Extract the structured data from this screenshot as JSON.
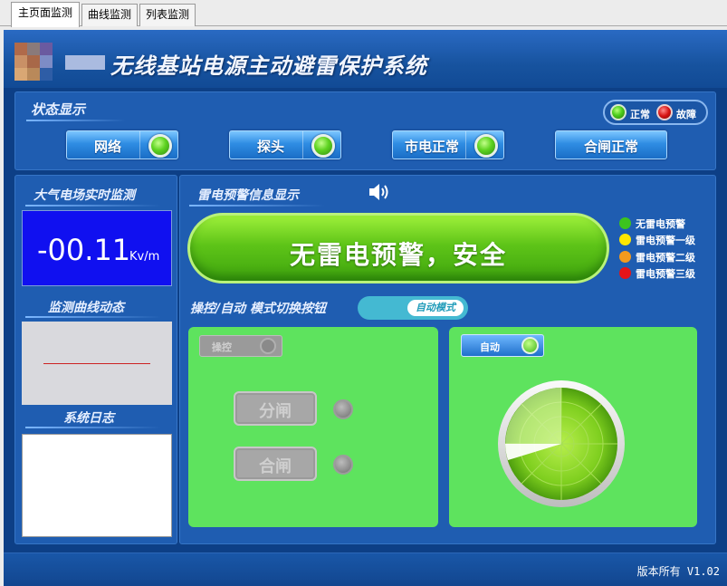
{
  "tabs": [
    {
      "label": "主页面监测",
      "active": true
    },
    {
      "label": "曲线监测",
      "active": false
    },
    {
      "label": "列表监测",
      "active": false
    }
  ],
  "header": {
    "title": "无线基站电源主动避雷保护系统"
  },
  "status_panel": {
    "title": "状态显示",
    "legend": {
      "ok": "正常",
      "fault": "故障"
    },
    "items": [
      {
        "label": "网络",
        "state": "正常"
      },
      {
        "label": "探头",
        "state": "正常"
      },
      {
        "label": "市电正常",
        "state": "正常"
      },
      {
        "label": "合闸正常"
      }
    ]
  },
  "field_monitor": {
    "title": "大气电场实时监测",
    "value": "-00.11",
    "unit": "Kv/m"
  },
  "curve": {
    "title": "监测曲线动态"
  },
  "log": {
    "title": "系统日志"
  },
  "warning": {
    "title": "雷电预警信息显示",
    "message": "无雷电预警，安全",
    "levels": [
      {
        "label": "无雷电预警",
        "color": "#3cc31e"
      },
      {
        "label": "雷电预警一级",
        "color": "#ffe600"
      },
      {
        "label": "雷电预警二级",
        "color": "#f39a1e"
      },
      {
        "label": "雷电预警三级",
        "color": "#e4141a"
      }
    ]
  },
  "mode": {
    "title": "操控/自动 模式切换按钮",
    "toggle_label": "自动模式"
  },
  "manual": {
    "switch_label": "操控",
    "open_button": "分闸",
    "close_button": "合闸"
  },
  "auto": {
    "switch_label": "自动"
  },
  "colors": {
    "accent_green": "#5ee35e",
    "panel_blue": "#1f5db1",
    "value_blue": "#1010f0"
  },
  "footer": {
    "version": "版本所有 V1.02"
  }
}
